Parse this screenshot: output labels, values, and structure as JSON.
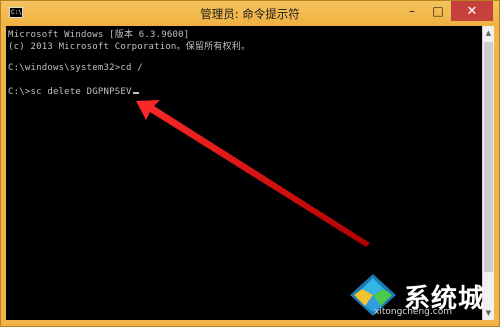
{
  "window": {
    "title": "管理员: 命令提示符",
    "icon_label": "C:\\",
    "controls": {
      "minimize": "–",
      "maximize": "□",
      "close": "✕"
    }
  },
  "console": {
    "lines": [
      "Microsoft Windows [版本 6.3.9600]",
      "(c) 2013 Microsoft Corporation。保留所有权利。",
      "C:\\windows\\system32>cd /",
      "C:\\>sc delete DGPNPSEV"
    ]
  },
  "watermark": {
    "brand": "系统城",
    "url": "xitongcheng.com"
  },
  "colors": {
    "frame": "#f0b44a",
    "close": "#c7413c",
    "console_bg": "#000000",
    "console_text": "#c0c0c0",
    "arrow": "#e01010"
  }
}
